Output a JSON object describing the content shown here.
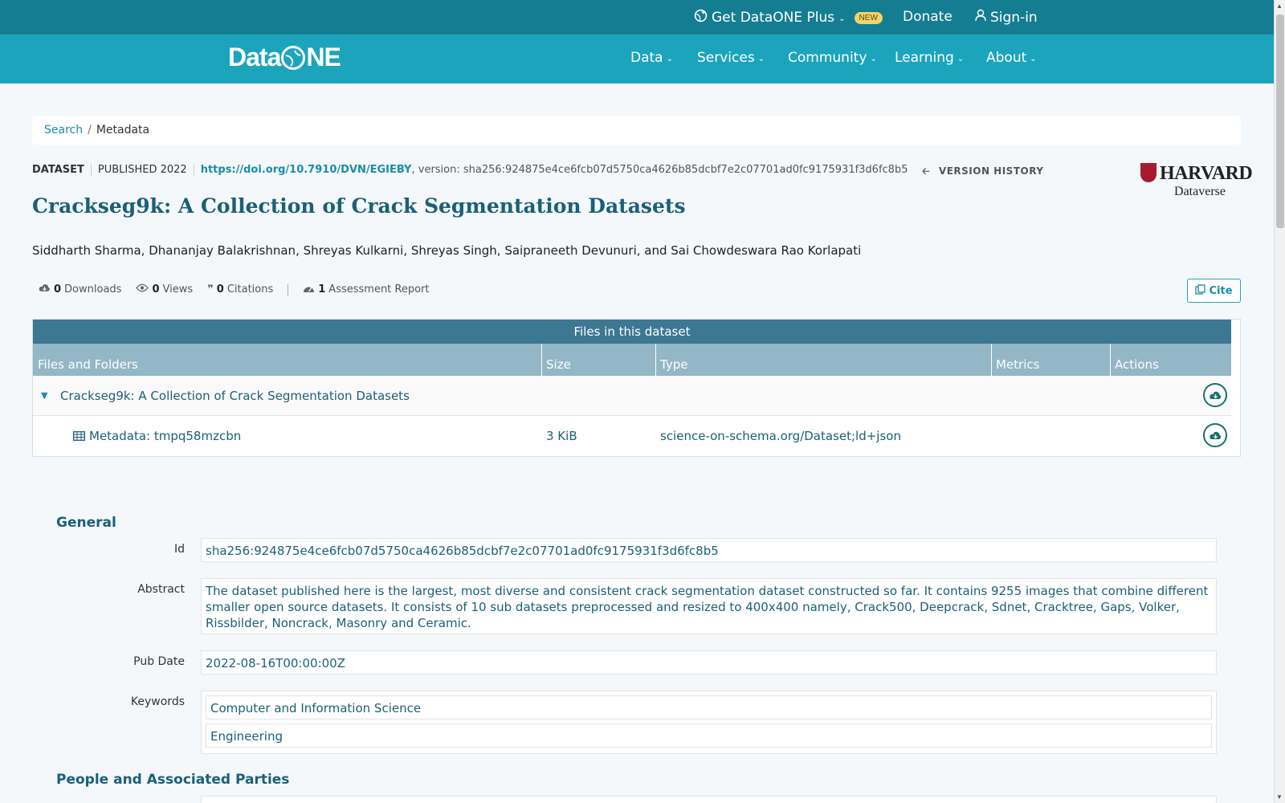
{
  "topbar": {
    "plus_label": "Get DataONE Plus",
    "new_badge": "NEW",
    "donate": "Donate",
    "signin": "Sign-in"
  },
  "navbar": {
    "logo_a": "Data",
    "logo_b": "NE",
    "items": [
      "Data",
      "Services",
      "Community",
      "Learning",
      "About"
    ]
  },
  "breadcrumb": {
    "search": "Search",
    "sep": "/",
    "current": "Metadata"
  },
  "dataset": {
    "type": "DATASET",
    "published": "PUBLISHED 2022",
    "doi": "https://doi.org/10.7910/DVN/EGIEBY",
    "version": ", version: sha256:924875e4ce6fcb07d5750ca4626b85dcbf7e2c07701ad0fc9175931f3d6fc8b5",
    "version_history": "VERSION HISTORY",
    "repo_name": "HARVARD",
    "repo_sub": "Dataverse",
    "title": "Crackseg9k: A Collection of Crack Segmentation Datasets",
    "authors": "Siddharth Sharma, Dhananjay Balakrishnan, Shreyas Kulkarni, Shreyas Singh, Saipraneeth Devunuri, and Sai Chowdeswara Rao Korlapati"
  },
  "metrics": {
    "downloads_count": "0",
    "downloads_label": "Downloads",
    "views_count": "0",
    "views_label": "Views",
    "citations_count": "0",
    "citations_label": "Citations",
    "assess_count": "1",
    "assess_label": "Assessment Report",
    "cite": "Cite"
  },
  "files": {
    "title": "Files in this dataset",
    "headers": [
      "Files and Folders",
      "Size",
      "Type",
      "Metrics",
      "Actions"
    ],
    "folder": "Crackseg9k: A Collection of Crack Segmentation Datasets",
    "file": {
      "name": "Metadata: tmpq58mzcbn",
      "size": "3 KiB",
      "type": "science-on-schema.org/Dataset;ld+json"
    }
  },
  "general": {
    "heading": "General",
    "id_label": "Id",
    "id_value": "sha256:924875e4ce6fcb07d5750ca4626b85dcbf7e2c07701ad0fc9175931f3d6fc8b5",
    "abstract_label": "Abstract",
    "abstract_value": "The dataset published here is the largest, most diverse and consistent crack segmentation dataset constructed so far. It contains 9255 images that combine different smaller open source datasets. It consists of 10 sub datasets preprocessed and resized to 400x400 namely, Crack500, Deepcrack, Sdnet, Cracktree, Gaps, Volker, Rissbilder, Noncrack, Masonry and Ceramic.",
    "pubdate_label": "Pub Date",
    "pubdate_value": "2022-08-16T00:00:00Z",
    "keywords_label": "Keywords",
    "keywords": [
      "Computer and Information Science",
      "Engineering"
    ]
  },
  "people": {
    "heading": "People and Associated Parties"
  },
  "colors": {
    "topbar": "#157d91",
    "navbar": "#1ca4bd",
    "title": "#1b5f78",
    "files_title": "#3c7891",
    "files_head": "#93b7c6"
  }
}
